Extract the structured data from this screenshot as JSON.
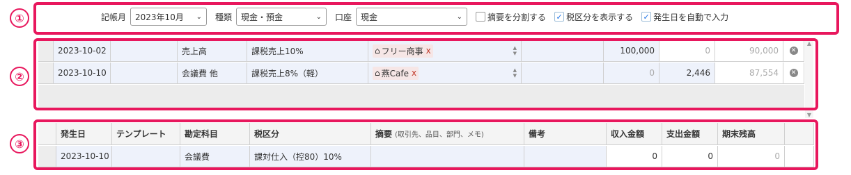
{
  "markers": [
    "①",
    "②",
    "③"
  ],
  "toolbar": {
    "month_label": "記帳月",
    "month_value": "2023年10月",
    "kind_label": "種類",
    "kind_value": "現金・預金",
    "account_label": "口座",
    "account_value": "現金",
    "split_summary_label": "摘要を分割する",
    "split_summary_checked": false,
    "show_tax_label": "税区分を表示する",
    "show_tax_checked": true,
    "auto_date_label": "発生日を自動で入力",
    "auto_date_checked": true
  },
  "entries": [
    {
      "date": "2023-10-02",
      "template": "",
      "account": "売上高",
      "tax": "課税売上10%",
      "partner": "フリー商事",
      "income": "100,000",
      "expense": "0",
      "balance": "90,000"
    },
    {
      "date": "2023-10-10",
      "template": "",
      "account": "会議費 他",
      "tax": "課税売上8%（軽）",
      "partner": "燕Cafe",
      "income": "0",
      "expense": "2,446",
      "balance": "87,554"
    }
  ],
  "form": {
    "headers": {
      "date": "発生日",
      "template": "テンプレート",
      "account": "勘定科目",
      "tax": "税区分",
      "summary": "摘要",
      "summary_note": "(取引先、品目、部門、メモ)",
      "remarks": "備考",
      "income": "収入金額",
      "expense": "支出金額",
      "balance": "期末残高"
    },
    "row": {
      "date": "2023-10-10",
      "template": "",
      "account": "会議費",
      "tax": "課対仕入（控80）10%",
      "summary": "",
      "remarks": "",
      "income": "0",
      "expense": "0",
      "balance": "0"
    }
  },
  "icons": {
    "tag": "home-icon",
    "delete": "close-circle-icon",
    "dropdown": "chevron-down-icon"
  }
}
